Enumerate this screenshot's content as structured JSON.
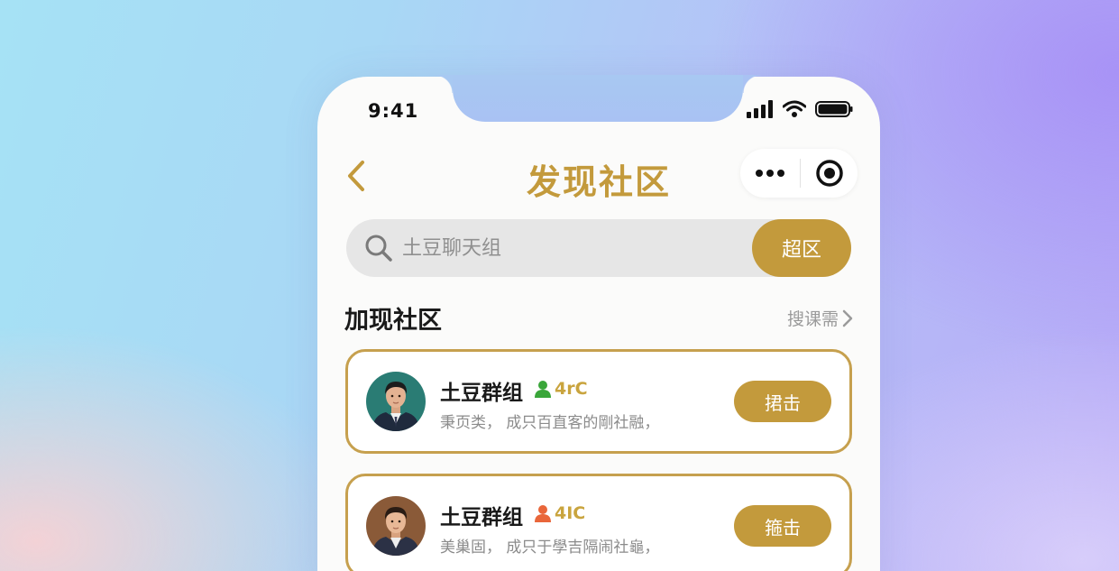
{
  "status_bar": {
    "time": "9:41"
  },
  "nav": {
    "title": "发现社区",
    "back_icon": "chevron-left-icon",
    "more_icon": "more-horizontal-icon",
    "close_icon": "target-icon"
  },
  "search": {
    "placeholder": "土豆聊天组",
    "button_label": "超区"
  },
  "section": {
    "title": "加现社区",
    "more_label": "搜课需"
  },
  "communities": [
    {
      "name": "土豆群组",
      "members": "4rC",
      "member_icon_color": "#3aa63a",
      "description": "秉页类， 成只百直客的剛社融，",
      "join_label": "捃击"
    },
    {
      "name": "土豆群组",
      "members": "4IC",
      "member_icon_color": "#e9663a",
      "description": "美巢固， 成只于學吉隔闹社龜，",
      "join_label": "箍击"
    }
  ],
  "colors": {
    "accent": "#c39a3c",
    "card_border": "#c6a04e"
  }
}
